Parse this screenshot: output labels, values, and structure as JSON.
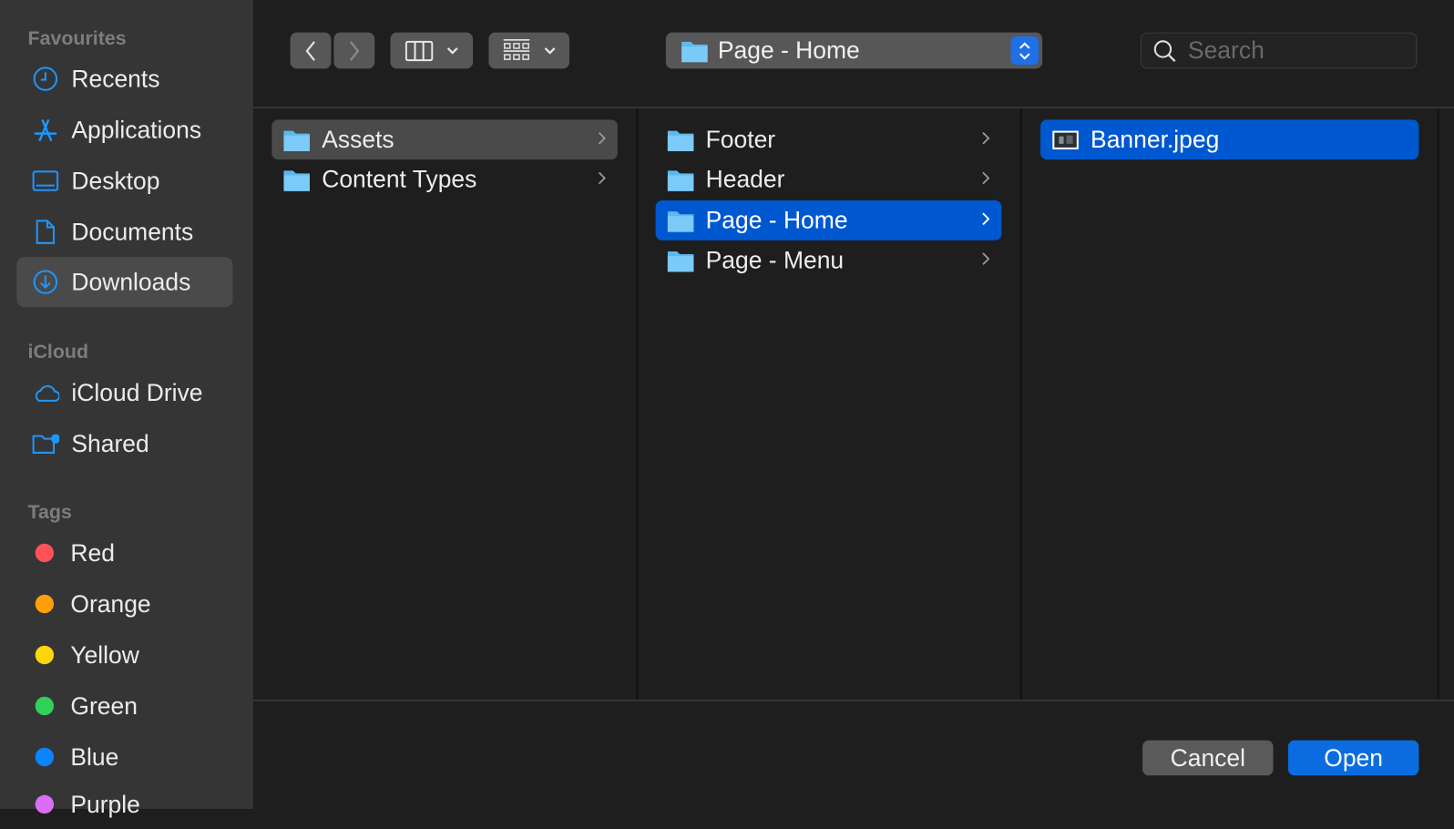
{
  "sidebar": {
    "favourites_label": "Favourites",
    "favourites": [
      {
        "label": "Recents",
        "icon": "clock-icon"
      },
      {
        "label": "Applications",
        "icon": "applications-icon"
      },
      {
        "label": "Desktop",
        "icon": "desktop-icon"
      },
      {
        "label": "Documents",
        "icon": "document-icon"
      },
      {
        "label": "Downloads",
        "icon": "download-icon",
        "selected": true
      }
    ],
    "icloud_label": "iCloud",
    "icloud": [
      {
        "label": "iCloud Drive",
        "icon": "cloud-icon"
      },
      {
        "label": "Shared",
        "icon": "shared-folder-icon"
      }
    ],
    "tags_label": "Tags",
    "tags": [
      {
        "label": "Red",
        "color": "#ff5257"
      },
      {
        "label": "Orange",
        "color": "#ff9f0a"
      },
      {
        "label": "Yellow",
        "color": "#ffd60a"
      },
      {
        "label": "Green",
        "color": "#30d158"
      },
      {
        "label": "Blue",
        "color": "#0a84ff"
      },
      {
        "label": "Purple",
        "color": "#da6ef5"
      }
    ]
  },
  "toolbar": {
    "path": "Page - Home",
    "search_placeholder": "Search",
    "search_value": ""
  },
  "columns": [
    {
      "items": [
        {
          "label": "Assets",
          "selected": "inactive"
        },
        {
          "label": "Content Types"
        }
      ]
    },
    {
      "items": [
        {
          "label": "Footer"
        },
        {
          "label": "Header"
        },
        {
          "label": "Page - Home",
          "selected": "active"
        },
        {
          "label": "Page - Menu"
        }
      ]
    },
    {
      "items": [
        {
          "label": "Banner.jpeg",
          "selected": "active",
          "icon": "image-thumbnail-icon"
        }
      ]
    }
  ],
  "buttons": {
    "cancel": "Cancel",
    "open": "Open"
  },
  "colors": {
    "accent": "#0058d0",
    "folder": "#5cb8f0",
    "sidebar_icon": "#1e96ff"
  }
}
